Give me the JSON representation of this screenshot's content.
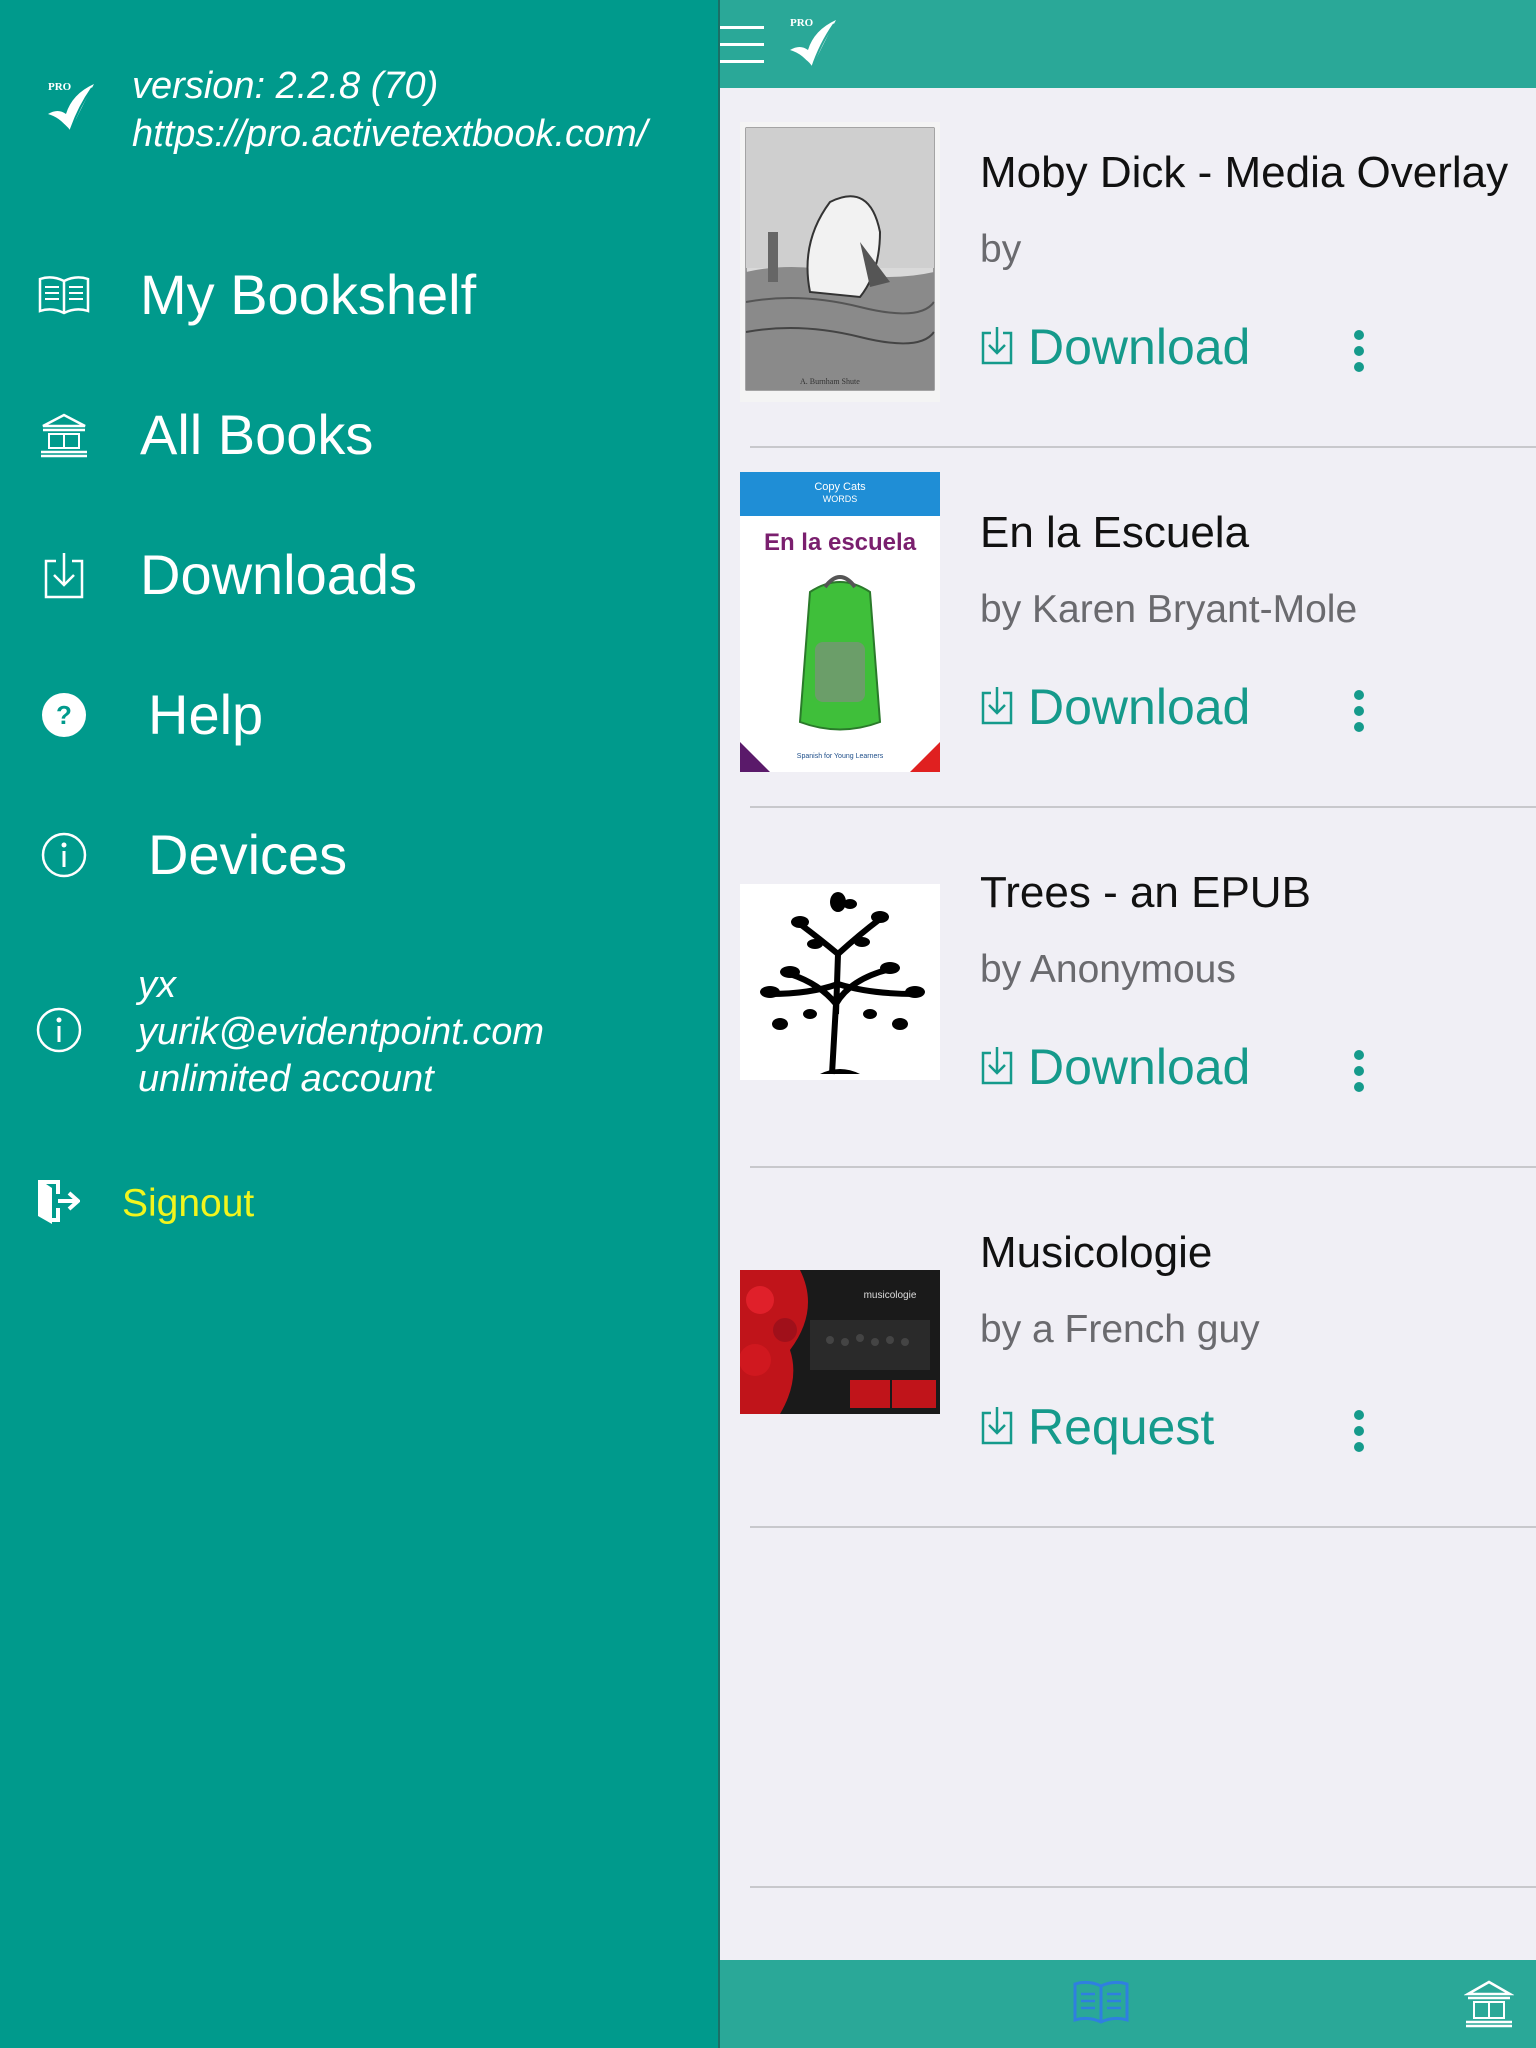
{
  "drawer": {
    "version": "version: 2.2.8 (70)",
    "url": "https://pro.activetextbook.com/",
    "logo_text": "PRO",
    "menu": [
      {
        "label": "My Bookshelf",
        "icon": "open-book-icon"
      },
      {
        "label": "All Books",
        "icon": "library-icon"
      },
      {
        "label": "Downloads",
        "icon": "download-icon"
      },
      {
        "label": "Help",
        "icon": "help-icon"
      },
      {
        "label": "Devices",
        "icon": "info-icon"
      }
    ],
    "account": {
      "name": "yx",
      "email": "yurik@evidentpoint.com",
      "plan": "unlimited account"
    },
    "signout": "Signout"
  },
  "topbar": {
    "logo_text": "PRO"
  },
  "books": [
    {
      "title": "Moby Dick - Media Overlay",
      "author": "by",
      "action": "Download",
      "cover": "whale-illustration"
    },
    {
      "title": "En la Escuela",
      "author": "by Karen Bryant-Mole",
      "action": "Download",
      "cover": "backpack",
      "cover_header": "Copy Cats",
      "cover_sub": "WORDS",
      "cover_title": "En la escuela",
      "cover_footer": "Spanish for Young Learners"
    },
    {
      "title": "Trees - an EPUB",
      "author": "by Anonymous",
      "action": "Download",
      "cover": "tree-silhouette"
    },
    {
      "title": "Musicologie",
      "author": "by a French guy",
      "action": "Request",
      "cover": "concert-red",
      "cover_title": "musicologie"
    }
  ],
  "colors": {
    "drawer": "#009a8c",
    "bar": "#2aa898",
    "accent": "#159a8b",
    "signout": "#f2f51d",
    "tab_active": "#2f7fe0"
  }
}
